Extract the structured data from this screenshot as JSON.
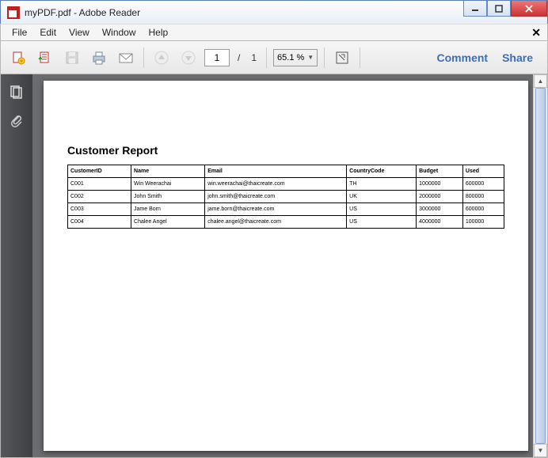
{
  "window": {
    "title": "myPDF.pdf - Adobe Reader"
  },
  "menu": {
    "file": "File",
    "edit": "Edit",
    "view": "View",
    "window": "Window",
    "help": "Help"
  },
  "toolbar": {
    "page_current": "1",
    "page_sep": "/",
    "page_total": "1",
    "zoom": "65.1 %",
    "comment": "Comment",
    "share": "Share"
  },
  "document": {
    "title": "Customer Report",
    "headers": {
      "c0": "CustomerID",
      "c1": "Name",
      "c2": "Email",
      "c3": "CountryCode",
      "c4": "Budget",
      "c5": "Used"
    },
    "rows": [
      {
        "c0": "C001",
        "c1": "Win Weerachai",
        "c2": "win.weerachai@thaicreate.com",
        "c3": "TH",
        "c4": "1000000",
        "c5": "600000"
      },
      {
        "c0": "C002",
        "c1": "John  Smith",
        "c2": "john.smith@thaicreate.com",
        "c3": "UK",
        "c4": "2000000",
        "c5": "800000"
      },
      {
        "c0": "C003",
        "c1": "Jame Born",
        "c2": "jame.born@thaicreate.com",
        "c3": "US",
        "c4": "3000000",
        "c5": "600000"
      },
      {
        "c0": "C004",
        "c1": "Chalee Angel",
        "c2": "chalee.angel@thaicreate.com",
        "c3": "US",
        "c4": "4000000",
        "c5": "100000"
      }
    ]
  }
}
